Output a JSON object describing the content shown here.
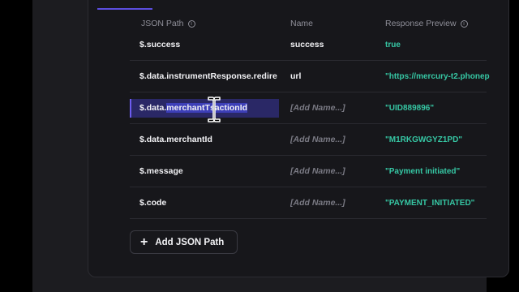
{
  "header": {
    "json_path": "JSON Path",
    "name": "Name",
    "response_preview": "Response Preview"
  },
  "rows": [
    {
      "path": "$.success",
      "name": "success",
      "preview": "true"
    },
    {
      "path": "$.data.instrumentResponse.redirec",
      "name": "url",
      "preview": "\"https://mercury-t2.phonep"
    },
    {
      "path_before": "$.data.",
      "path_selected": "merchantT",
      "path_after": "saction",
      "path_selected2": "Id",
      "name": "[Add Name...]",
      "preview": "\"UID889896\""
    },
    {
      "path": "$.data.merchantId",
      "name": "[Add Name...]",
      "preview": "\"M1RKGWGYZ1PD\""
    },
    {
      "path": "$.message",
      "name": "[Add Name...]",
      "preview": "\"Payment initiated\""
    },
    {
      "path": "$.code",
      "name": "[Add Name...]",
      "preview": "\"PAYMENT_INITIATED\""
    }
  ],
  "add_button": {
    "label": "Add JSON Path",
    "icon": "plus-icon"
  },
  "colors": {
    "accent": "#5b4ee0",
    "preview_text": "#36c7a4",
    "selection": "#3d3fb8"
  }
}
